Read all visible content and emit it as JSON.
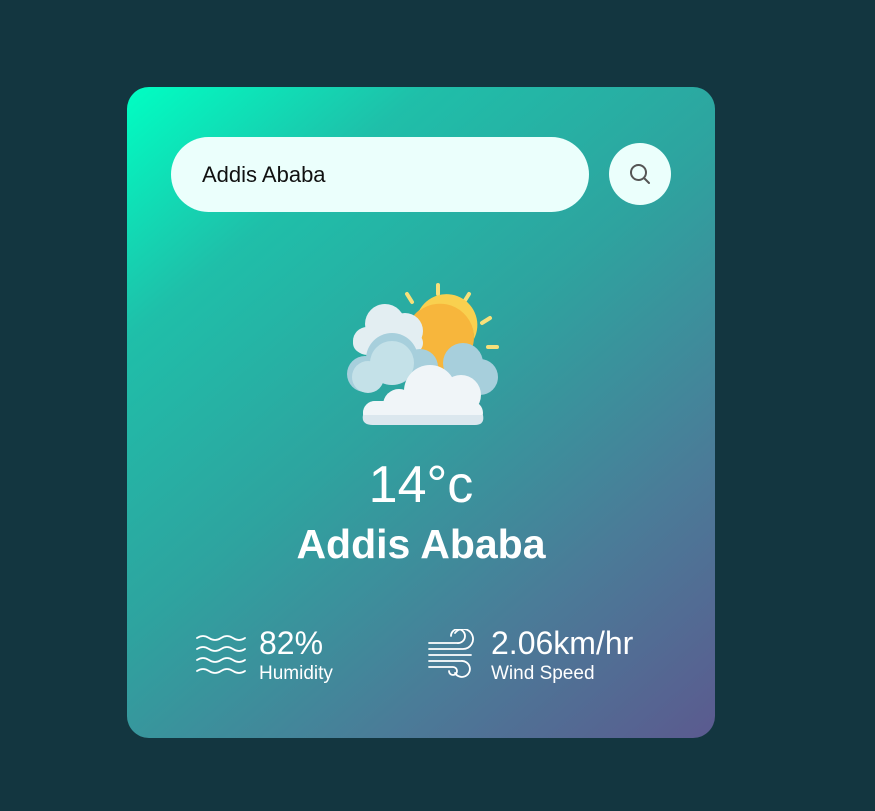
{
  "search": {
    "value": "Addis Ababa",
    "placeholder": ""
  },
  "search_button": {
    "icon": "search-icon"
  },
  "weather": {
    "icon": "partly-cloudy-icon",
    "temperature": "14°c",
    "city": "Addis Ababa"
  },
  "details": {
    "humidity": {
      "icon": "humidity-icon",
      "value": "82%",
      "label": "Humidity"
    },
    "wind": {
      "icon": "wind-icon",
      "value": "2.06km/hr",
      "label": "Wind Speed"
    }
  },
  "colors": {
    "page_background": "#133640",
    "card_gradient_start": "#00ffc3",
    "card_gradient_end": "#5b5a8f",
    "input_background": "#ebfffc",
    "text": "#ffffff"
  }
}
